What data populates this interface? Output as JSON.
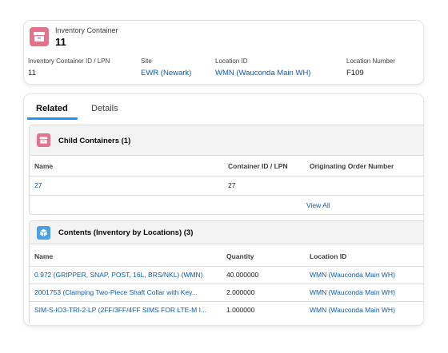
{
  "header": {
    "object_type": "Inventory Container",
    "record_name": "11",
    "fields": [
      {
        "label": "Inventory Container ID / LPN",
        "value": "11",
        "is_link": false
      },
      {
        "label": "Site",
        "value": "EWR (Newark)",
        "is_link": true
      },
      {
        "label": "Location ID",
        "value": "WMN (Wauconda Main WH)",
        "is_link": true
      },
      {
        "label": "Location Number",
        "value": "F109",
        "is_link": false
      }
    ]
  },
  "tabs": [
    {
      "label": "Related",
      "active": true
    },
    {
      "label": "Details",
      "active": false
    }
  ],
  "child_containers": {
    "title": "Child Containers (1)",
    "columns": [
      "Name",
      "Container ID / LPN",
      "Originating Order Number"
    ],
    "rows": [
      {
        "name": "27",
        "container_id": "27",
        "order_number": ""
      }
    ],
    "view_all": "View All"
  },
  "contents": {
    "title": "Contents (Inventory by Locations) (3)",
    "columns": [
      "Name",
      "Quantity",
      "Location ID"
    ],
    "rows": [
      {
        "name": "0.972 (GRIPPER, SNAP, POST, 16L, BRS/NKL) (WMN)",
        "quantity": "40.000000",
        "location": "WMN (Wauconda Main WH)"
      },
      {
        "name": "2001753 (Clamping Two-Piece Shaft Collar with Key...",
        "quantity": "2.000000",
        "location": "WMN (Wauconda Main WH)"
      },
      {
        "name": "SIM-S-IO3-TRI-2-LP (2FF/3FF/4FF SIMS FOR LTE-M I...",
        "quantity": "1.000000",
        "location": "WMN (Wauconda Main WH)"
      }
    ]
  },
  "icons": {
    "header": "inventory-box-icon",
    "child_containers": "inventory-box-icon",
    "contents": "cube-icon"
  },
  "colors": {
    "container_icon": "#e3738b",
    "contents_icon": "#4aa0e6",
    "link": "#0b5cab",
    "tab_accent": "#1b96ff"
  }
}
